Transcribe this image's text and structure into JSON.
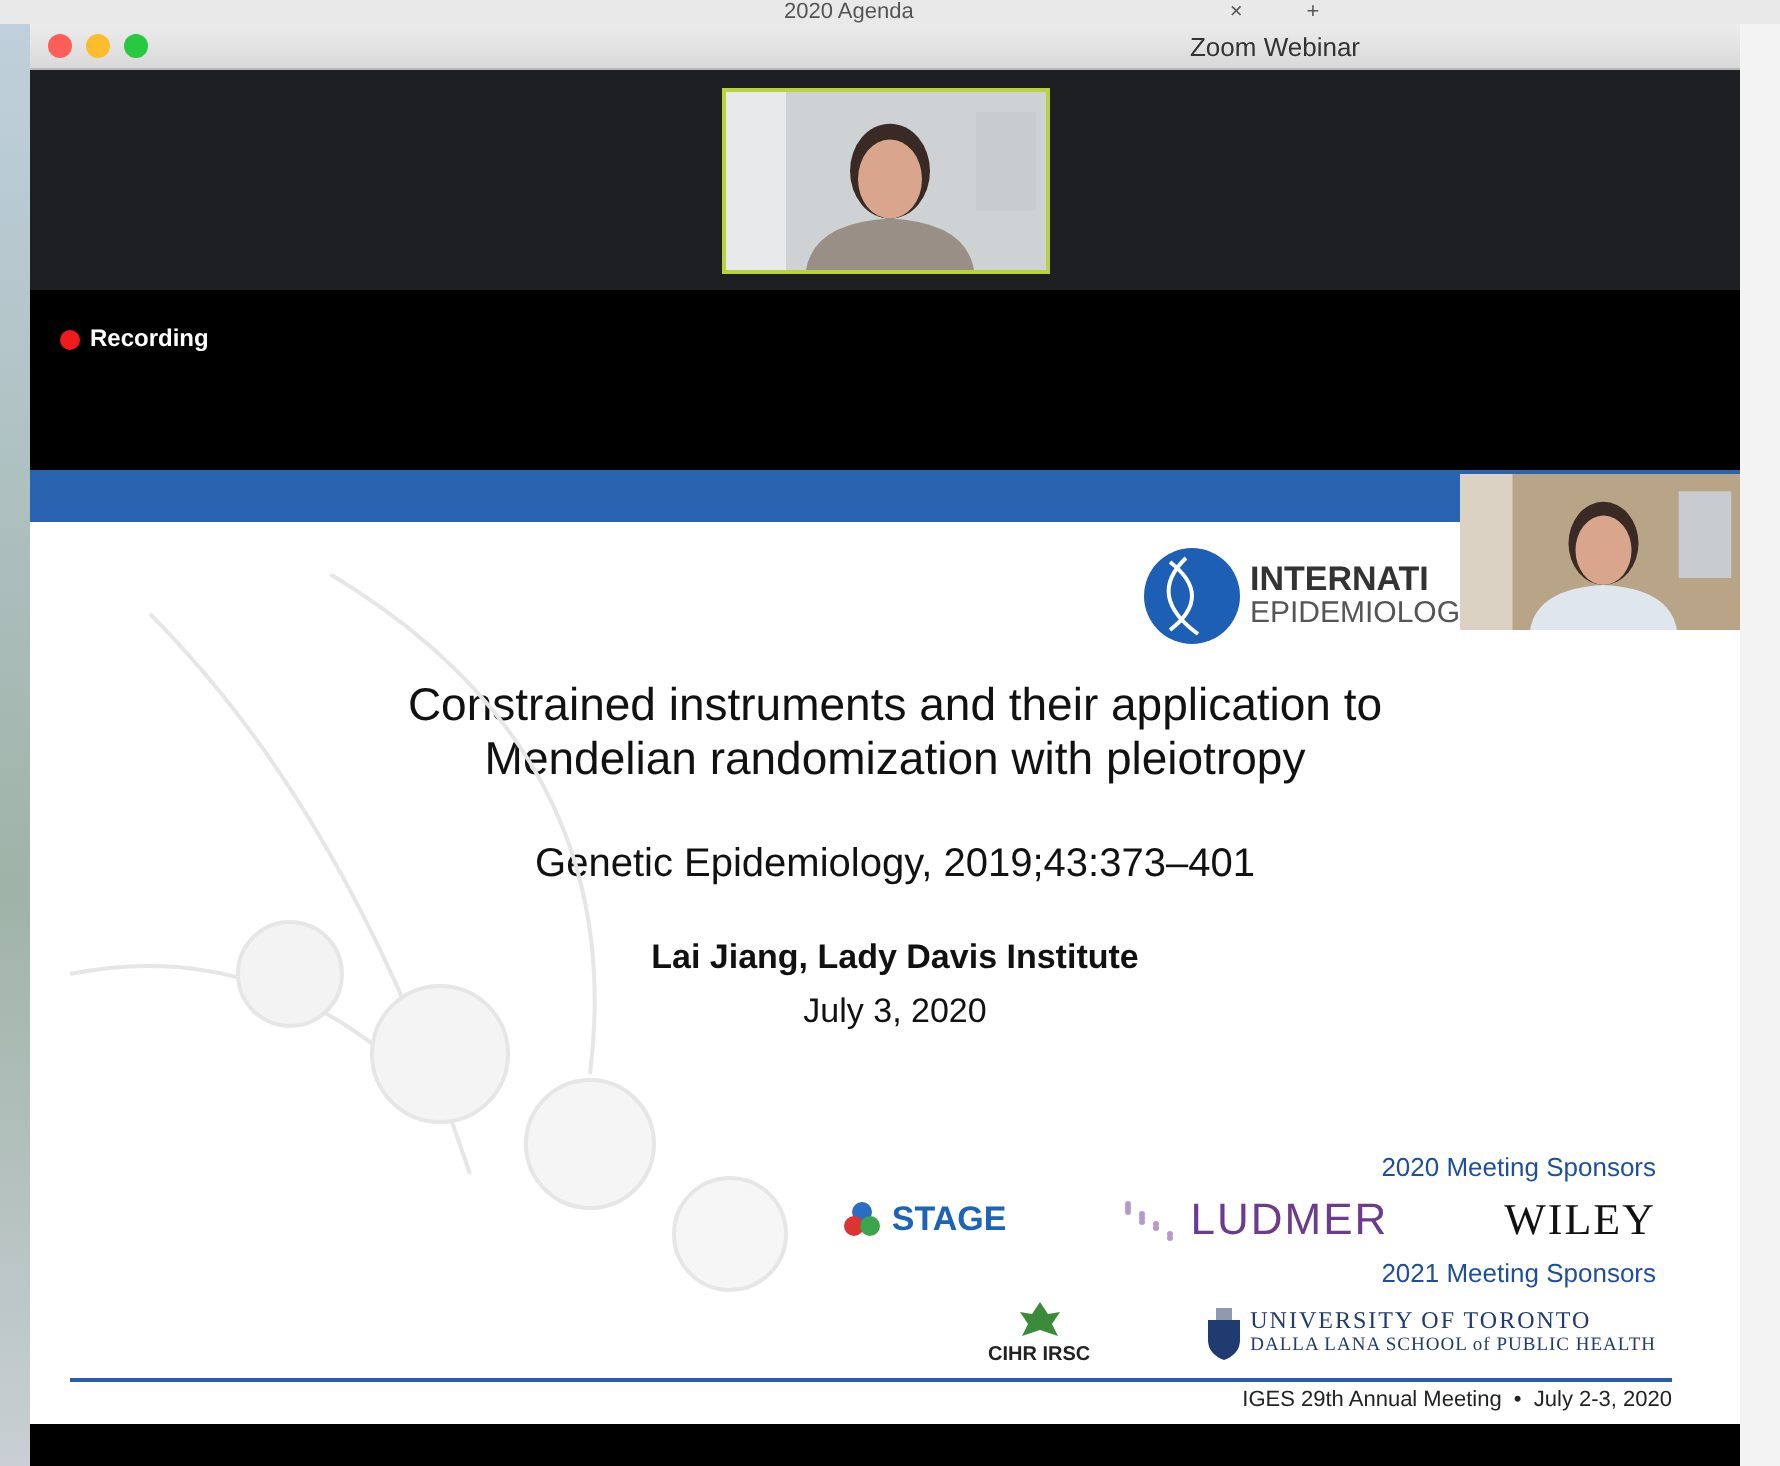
{
  "background_tab": {
    "title": "2020 Agenda",
    "close": "×",
    "new_tab": "+"
  },
  "window": {
    "title": "Zoom Webinar"
  },
  "recording": {
    "label": "Recording",
    "on": true
  },
  "slide": {
    "society_logo": [
      "INTERNATI",
      "EPIDEMIOLOG"
    ],
    "title_lines": [
      "Constrained instruments and their application to",
      "Mendelian randomization with pleiotropy"
    ],
    "citation": "Genetic Epidemiology, 2019;43:373–401",
    "author": "Lai Jiang, Lady Davis Institute",
    "date": "July 3, 2020",
    "sponsor_groups": [
      {
        "heading": "2020 Meeting Sponsors",
        "logos": [
          {
            "kind": "stage",
            "text": "STAGE"
          },
          {
            "kind": "ludmer",
            "text": "LUDMER"
          },
          {
            "kind": "wiley",
            "text": "WILEY"
          }
        ]
      },
      {
        "heading": "2021 Meeting Sponsors",
        "logos": [
          {
            "kind": "cihr",
            "text": "CIHR IRSC"
          },
          {
            "kind": "uoft",
            "text": "UNIVERSITY OF TORONTO",
            "subtext": "DALLA LANA SCHOOL of PUBLIC HEALTH"
          }
        ]
      }
    ],
    "footer": "IGES 29th Annual Meeting  •  July 2-3, 2020"
  }
}
